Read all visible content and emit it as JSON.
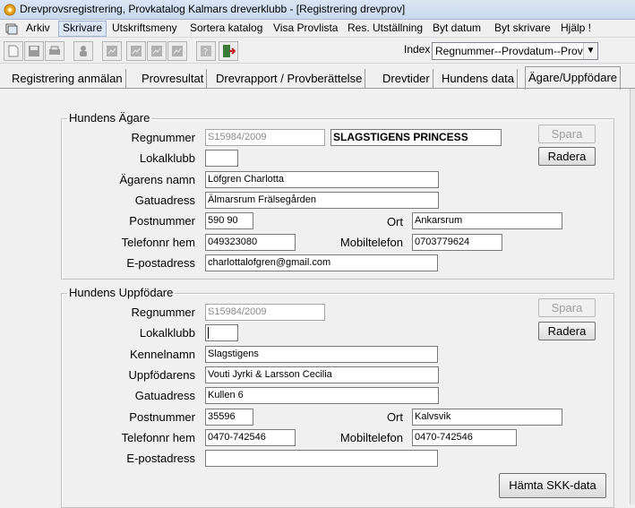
{
  "window": {
    "title": "Drevprovsregistrering, Provkatalog  Kalmars dreverklubb - [Registrering drevprov]"
  },
  "menu": [
    {
      "label": "Arkiv"
    },
    {
      "label": "Skrivare"
    },
    {
      "label": "Utskriftsmeny"
    },
    {
      "label": "Sortera katalog"
    },
    {
      "label": "Visa Provlista"
    },
    {
      "label": "Res. Utställning"
    },
    {
      "label": "Byt datum"
    },
    {
      "label": "Byt skrivare"
    },
    {
      "label": "Hjälp !"
    }
  ],
  "toolbar": {
    "index_label": "Index",
    "index_value": "Regnummer--Provdatum--Provnr",
    "icons": [
      "new-icon",
      "save-icon",
      "print-icon",
      "user-icon",
      "form-icon",
      "form-icon",
      "form-icon",
      "help-icon",
      "exit-icon"
    ]
  },
  "tabs": [
    {
      "label": "Registrering anmälan"
    },
    {
      "label": "Provresultat"
    },
    {
      "label": "Drevrapport / Provberättelse"
    },
    {
      "label": "Drevtider"
    },
    {
      "label": "Hundens data"
    },
    {
      "label": "Ägare/Uppfödare",
      "active": true
    }
  ],
  "owner": {
    "legend": "Hundens Ägare",
    "labels": {
      "regnummer": "Regnummer",
      "lokalklubb": "Lokalklubb",
      "namn": "Ägarens namn",
      "gatuadress": "Gatuadress",
      "postnummer": "Postnummer",
      "ort": "Ort",
      "telefon": "Telefonnr hem",
      "mobil": "Mobiltelefon",
      "epost": "E-postadress"
    },
    "values": {
      "regnummer": "S15984/2009",
      "hundnamn": "SLAGSTIGENS PRINCESS",
      "lokalklubb": "",
      "namn": "Löfgren Charlotta",
      "gatuadress": "Älmarsrum Frälsegården",
      "postnummer": "590 90",
      "ort": "Ankarsrum",
      "telefon": "049323080",
      "mobil": "0703779624",
      "epost": "charlottalofgren@gmail.com"
    },
    "buttons": {
      "spara": "Spara",
      "radera": "Radera"
    }
  },
  "breeder": {
    "legend": "Hundens Uppfödare",
    "labels": {
      "regnummer": "Regnummer",
      "lokalklubb": "Lokalklubb",
      "kennelnamn": "Kennelnamn",
      "uppfodarens": "Uppfödarens",
      "gatuadress": "Gatuadress",
      "postnummer": "Postnummer",
      "ort": "Ort",
      "telefon": "Telefonnr hem",
      "mobil": "Mobiltelefon",
      "epost": "E-postadress"
    },
    "values": {
      "regnummer": "S15984/2009",
      "lokalklubb": "",
      "kennelnamn": "Slagstigens",
      "uppfodarens": "Vouti Jyrki & Larsson Cecilia",
      "gatuadress": "Kullen 6",
      "postnummer": "35596",
      "ort": "Kalvsvik",
      "telefon": "0470-742546",
      "mobil": "0470-742546",
      "epost": ""
    },
    "buttons": {
      "spara": "Spara",
      "radera": "Radera",
      "hamta": "Hämta SKK-data"
    }
  }
}
